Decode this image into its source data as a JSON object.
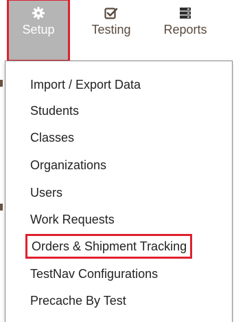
{
  "nav": {
    "tabs": [
      {
        "label": "Setup",
        "icon": "gear-icon",
        "active": true
      },
      {
        "label": "Testing",
        "icon": "checkbox-icon",
        "active": false
      },
      {
        "label": "Reports",
        "icon": "server-stack-icon",
        "active": false
      }
    ]
  },
  "menu": {
    "items": [
      {
        "label": "Import / Export Data"
      },
      {
        "label": "Students"
      },
      {
        "label": "Classes"
      },
      {
        "label": "Organizations"
      },
      {
        "label": "Users"
      },
      {
        "label": "Work Requests"
      },
      {
        "label": "Orders & Shipment Tracking",
        "highlighted": true
      },
      {
        "label": "TestNav Configurations"
      },
      {
        "label": "Precache By Test"
      }
    ]
  },
  "colors": {
    "highlight_border": "#e0202e",
    "active_tab_bg": "#b5b5b5",
    "nav_text": "#5a4a3e",
    "menu_text": "#222222"
  }
}
